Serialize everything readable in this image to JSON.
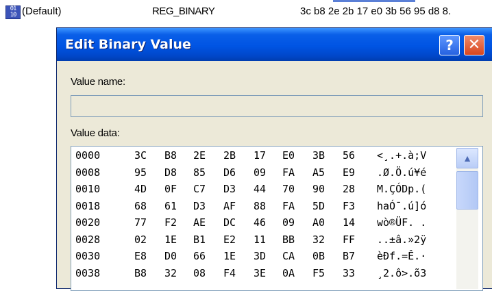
{
  "registry": {
    "value_name": "(Default)",
    "value_type": "REG_BINARY",
    "value_data": "3c b8 2e 2b 17 e0 3b 56 95 d8 8."
  },
  "dialog": {
    "title": "Edit Binary Value",
    "help_label": "?",
    "close_label": "✕",
    "value_name_label": "Value name:",
    "value_name": "",
    "value_data_label": "Value data:",
    "scroll_up_label": "▲"
  },
  "hex_rows": [
    {
      "addr": "0000",
      "bytes": [
        "3C",
        "B8",
        "2E",
        "2B",
        "17",
        "E0",
        "3B",
        "56"
      ],
      "ascii": "<¸.+.à;V"
    },
    {
      "addr": "0008",
      "bytes": [
        "95",
        "D8",
        "85",
        "D6",
        "09",
        "FA",
        "A5",
        "E9"
      ],
      "ascii": ".Ø.Ö.ú¥é"
    },
    {
      "addr": "0010",
      "bytes": [
        "4D",
        "0F",
        "C7",
        "D3",
        "44",
        "70",
        "90",
        "28"
      ],
      "ascii": "M.ÇÓDp.("
    },
    {
      "addr": "0018",
      "bytes": [
        "68",
        "61",
        "D3",
        "AF",
        "88",
        "FA",
        "5D",
        "F3"
      ],
      "ascii": "haÓ¯.ú]ó"
    },
    {
      "addr": "0020",
      "bytes": [
        "77",
        "F2",
        "AE",
        "DC",
        "46",
        "09",
        "A0",
        "14"
      ],
      "ascii": "wò®ÜF. ."
    },
    {
      "addr": "0028",
      "bytes": [
        "02",
        "1E",
        "B1",
        "E2",
        "11",
        "BB",
        "32",
        "FF"
      ],
      "ascii": "..±â.»2ÿ"
    },
    {
      "addr": "0030",
      "bytes": [
        "E8",
        "D0",
        "66",
        "1E",
        "3D",
        "CA",
        "0B",
        "B7"
      ],
      "ascii": "èÐf.=Ê.·"
    },
    {
      "addr": "0038",
      "bytes": [
        "B8",
        "32",
        "08",
        "F4",
        "3E",
        "0A",
        "F5",
        "33"
      ],
      "ascii": "¸2.ô>.õ3"
    }
  ]
}
